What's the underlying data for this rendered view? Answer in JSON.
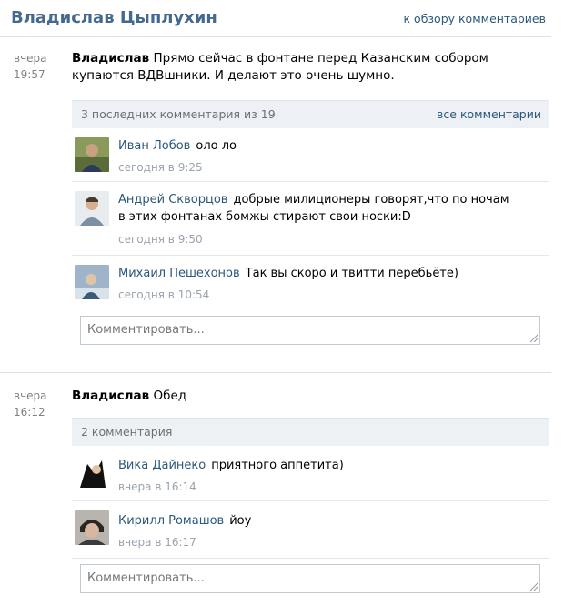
{
  "header": {
    "title": "Владислав Цыплухин",
    "back_link": "к обзору комментариев"
  },
  "posts": [
    {
      "date_day": "вчера",
      "date_time": "19:57",
      "author": "Владислав",
      "text": "Прямо сейчас в фонтане перед Казанским собором купаются ВДВшники. И делают это очень шумно.",
      "comments_summary": "3 последних комментария из 19",
      "all_comments": "все комментарии",
      "comments": [
        {
          "author": "Иван Лобов",
          "text": "оло ло",
          "date": "сегодня в 9:25"
        },
        {
          "author": "Андрей Скворцов",
          "text": "добрые милиционеры говорят,что по ночам в этих фонтанах бомжы стирают свои носки:D",
          "date": "сегодня в 9:50"
        },
        {
          "author": "Михаил Пешехонов",
          "text": "Так вы скоро и твитти перебьёте)",
          "date": "сегодня в 10:54"
        }
      ],
      "comment_placeholder": "Комментировать..."
    },
    {
      "date_day": "вчера",
      "date_time": "16:12",
      "author": "Владислав",
      "text": "Обед",
      "comments_summary": "2 комментария",
      "comments": [
        {
          "author": "Вика Дайнеко",
          "text": "приятного аппетита)",
          "date": "вчера в 16:14"
        },
        {
          "author": "Кирилл Ромашов",
          "text": "йоу",
          "date": "вчера в 16:17"
        }
      ],
      "comment_placeholder": "Комментировать..."
    }
  ],
  "colors": {
    "link": "#2b587a",
    "title": "#45688e",
    "bar": "#edf1f5"
  }
}
